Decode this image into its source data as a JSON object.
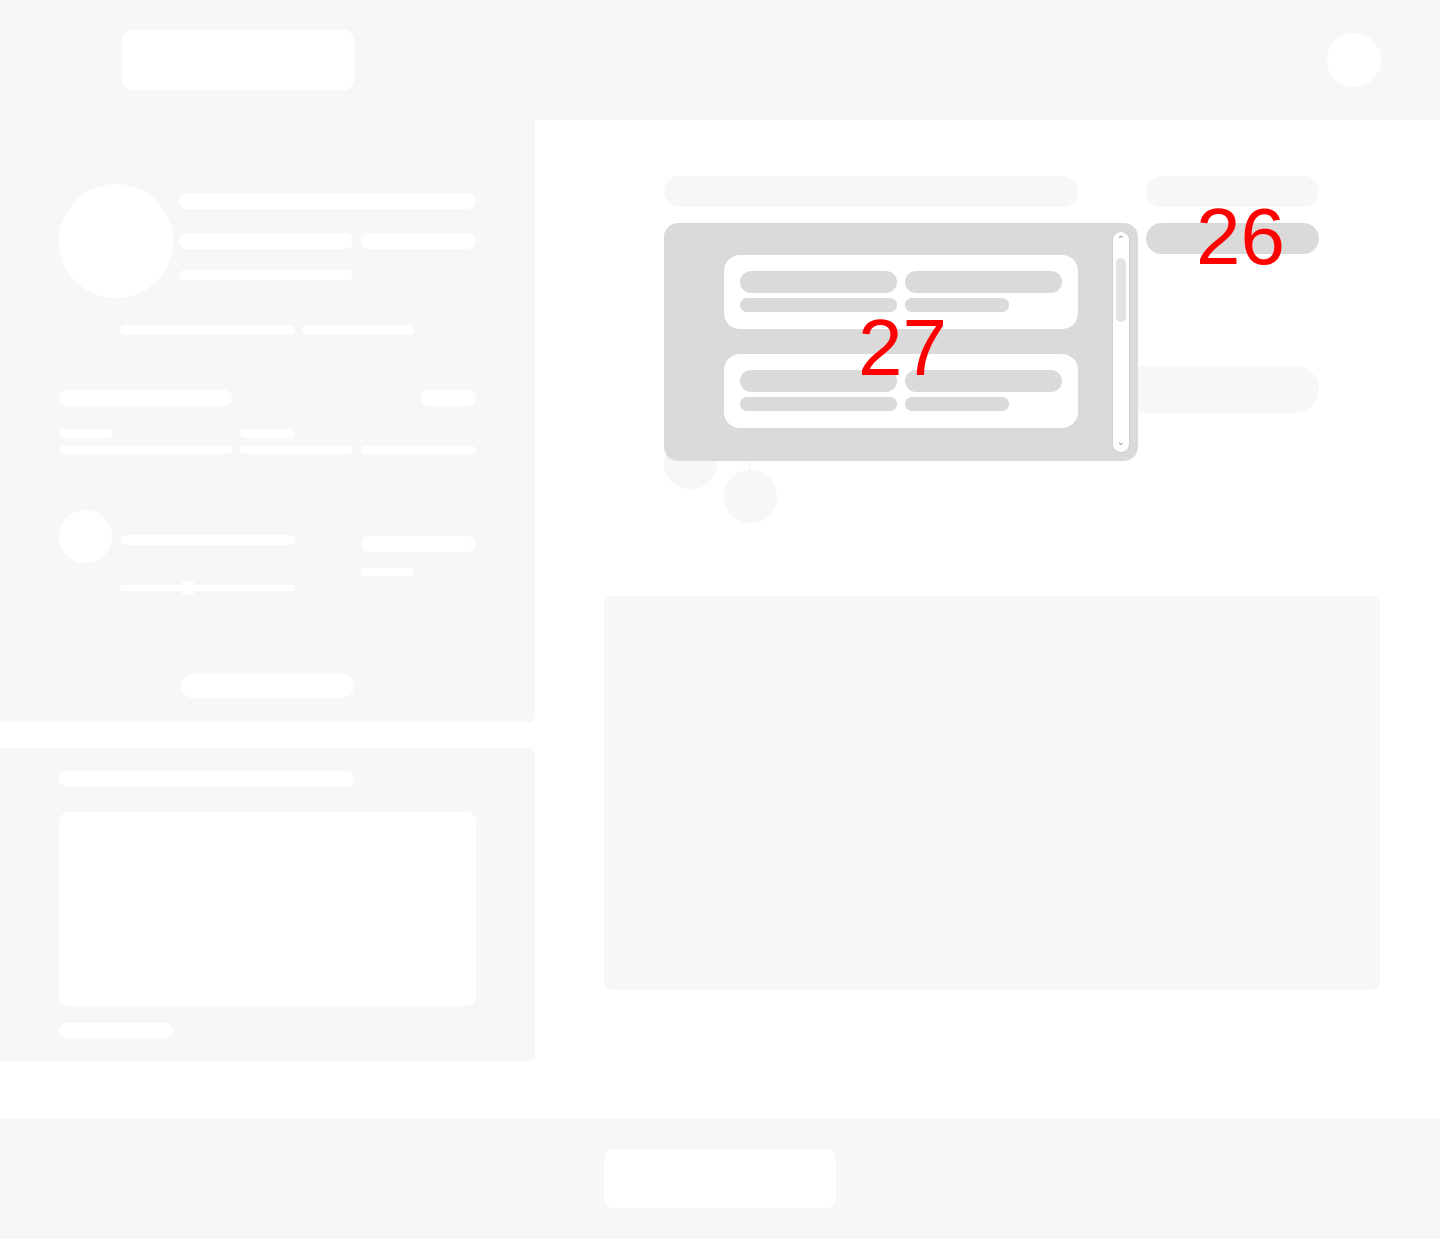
{
  "annotations": {
    "label_26": "26",
    "label_27": "27"
  },
  "popup": {
    "scroll_up_icon": "chevron-up-icon",
    "scroll_down_icon": "chevron-down-icon"
  },
  "colors": {
    "placeholder_light": "#f7f7f7",
    "placeholder_gray": "#dadada",
    "marker": "#ff0000"
  }
}
